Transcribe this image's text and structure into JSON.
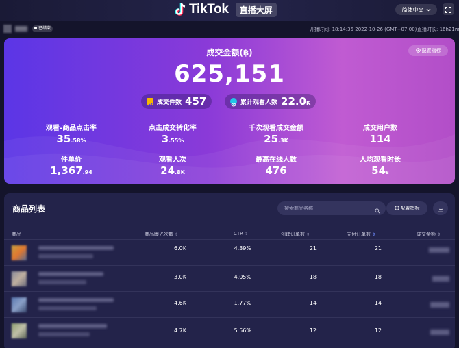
{
  "header": {
    "brand": "TikTok",
    "badge": "直播大屏",
    "language": "简体中文",
    "accent_color": "#ffffff"
  },
  "status": {
    "live_badge": "已结束",
    "start_time": "开播时间: 18:14:35 2022-10-26 (GMT+07:00)",
    "duration": "直播时长: 16h21m"
  },
  "hero": {
    "gmv_label": "成交金额(฿)",
    "gmv_value": "625,151",
    "config_button": "配置指标",
    "pills": [
      {
        "label": "成交件数",
        "value": "457",
        "unit": "",
        "icon": "chart-icon",
        "color": "#f5b700"
      },
      {
        "label": "累计观看人数",
        "value": "22.0",
        "unit": "K",
        "icon": "eye-icon",
        "color": "#22c6e8"
      }
    ],
    "metrics": [
      {
        "label": "观看-商品点击率",
        "value": "35",
        "suffix": ".58%"
      },
      {
        "label": "点击成交转化率",
        "value": "3",
        "suffix": ".55%"
      },
      {
        "label": "千次观看成交金额",
        "value": "25",
        "suffix": ".3K"
      },
      {
        "label": "成交用户数",
        "value": "114",
        "suffix": ""
      },
      {
        "label": "件单价",
        "value": "1,367",
        "suffix": ".94"
      },
      {
        "label": "观看人次",
        "value": "24",
        "suffix": ".8K"
      },
      {
        "label": "最高在线人数",
        "value": "476",
        "suffix": ""
      },
      {
        "label": "人均观看时长",
        "value": "54",
        "suffix": "s"
      }
    ],
    "gradient_colors": [
      "#5b36e6",
      "#8a3ad8",
      "#c05bd2"
    ]
  },
  "product_list": {
    "title": "商品列表",
    "search_placeholder": "搜索商品名称",
    "config_button": "配置指标",
    "columns": [
      "商品",
      "商品曝光次数",
      "CTR",
      "创建订单数",
      "支付订单数",
      "成交金额"
    ],
    "rows": [
      {
        "impressions": "6.0K",
        "ctr": "4.39%",
        "created_orders": "21",
        "paid_orders": "21"
      },
      {
        "impressions": "3.0K",
        "ctr": "4.05%",
        "created_orders": "18",
        "paid_orders": "18"
      },
      {
        "impressions": "4.6K",
        "ctr": "1.77%",
        "created_orders": "14",
        "paid_orders": "14"
      },
      {
        "impressions": "4.7K",
        "ctr": "5.56%",
        "created_orders": "12",
        "paid_orders": "12"
      }
    ]
  }
}
